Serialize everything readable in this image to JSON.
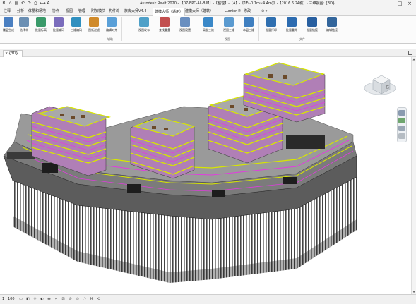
{
  "window": {
    "title": "Autodesk Revit 2020 - 【07-EPC-AL-BIM】-【整理】-【A】-【1F(-0.1m~4.4m)】-【2016.6.24稿】- 三维视图: {3D}",
    "quick_access": [
      "revit-logo",
      "open",
      "save",
      "undo",
      "redo",
      "print",
      "measure",
      "text-A"
    ],
    "controls": [
      "minimize",
      "maximize",
      "close"
    ]
  },
  "menu": {
    "items": [
      "注释",
      "分析",
      "体量和场地",
      "协作",
      "视图",
      "管理",
      "附加模块",
      "构件坞",
      "族库大师V4.4",
      "建模大师（通用）",
      "建模大师（建筑）",
      "Lumion®",
      "修改"
    ],
    "active_index": 9
  },
  "ribbon": {
    "buttons": [
      {
        "label": "楼层生成",
        "color": "#4a7fc1"
      },
      {
        "label": "选择单",
        "color": "#6b8fb3"
      },
      {
        "label": "批量标高",
        "color": "#3a9a6a"
      },
      {
        "label": "批量编码",
        "color": "#7a6cbc"
      },
      {
        "label": "三维编码",
        "color": "#2f8fbf"
      },
      {
        "label": "图纸过滤",
        "color": "#d08a2a"
      },
      {
        "label": "编辑对齐",
        "color": "#5aa0d8"
      },
      {
        "label": "视图发布",
        "color": "#4fa0c8"
      },
      {
        "label": "查找重叠",
        "color": "#c24f4f"
      },
      {
        "label": "视图设置",
        "color": "#6a8fc0"
      },
      {
        "label": "局部三维",
        "color": "#3a88c8"
      },
      {
        "label": "视图三维",
        "color": "#5a9ad0"
      },
      {
        "label": "本层三维",
        "color": "#3f7fc0"
      },
      {
        "label": "批量打印",
        "color": "#2f6fb0"
      },
      {
        "label": "批量重命",
        "color": "#2c6bb0"
      },
      {
        "label": "批量链接",
        "color": "#285fa0"
      },
      {
        "label": "编辑链接",
        "color": "#33669c"
      }
    ],
    "panels": [
      "辅助",
      "视图",
      "文件"
    ]
  },
  "view_tab": {
    "label": "{3D}",
    "close": "×"
  },
  "viewcube": {
    "face_label": "右"
  },
  "statusbar": {
    "scale": "1 : 100"
  }
}
